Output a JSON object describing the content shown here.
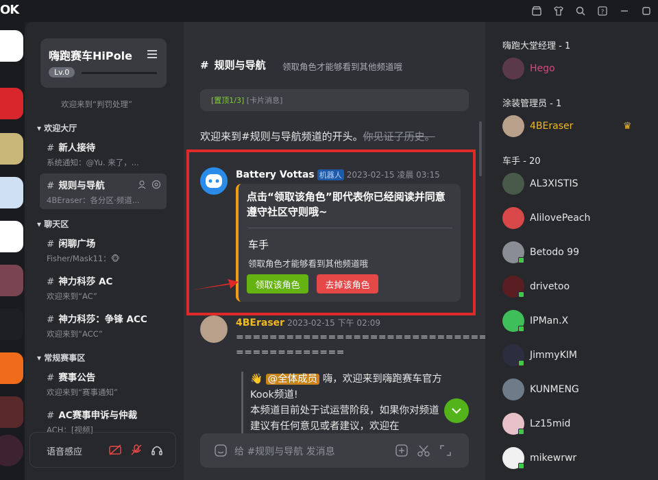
{
  "app": {
    "logo": "OK"
  },
  "guild": {
    "name": "嗨跑赛车HiPole",
    "level": "Lv.0",
    "top_sub": "欢迎来到“判罚处理”"
  },
  "categories": [
    {
      "label": "欢迎大厅",
      "channels": [
        {
          "name": "新人接待",
          "sub": "系统通知：@Yu. 来了，...",
          "active": false
        },
        {
          "name": "规则与导航",
          "sub": "4BEraser：各分区·频道...",
          "active": true
        }
      ]
    },
    {
      "label": "聊天区",
      "channels": [
        {
          "name": "闲聊广场",
          "sub": "Fisher/Mask11：🐵",
          "active": false
        },
        {
          "name": "神力科莎 AC",
          "sub": "欢迎来到“AC”",
          "active": false
        },
        {
          "name": "神力科莎：争锋 ACC",
          "sub": "欢迎来到“ACC”",
          "active": false
        }
      ]
    },
    {
      "label": "常规赛事区",
      "channels": [
        {
          "name": "赛事公告",
          "sub": "欢迎来到“赛事通知”",
          "active": false
        },
        {
          "name": "AC赛事申诉与仲裁",
          "sub": "ACH：[视频]",
          "active": false
        }
      ]
    }
  ],
  "voice": {
    "label": "语音感应"
  },
  "channel": {
    "name": "规则与导航",
    "topic": "领取角色才能够看到其他频道哦"
  },
  "pinbar": {
    "pin": "[置顶1/3]",
    "text": "[卡片消息]"
  },
  "welcome": {
    "text": "欢迎来到#规则与导航频道的开头。",
    "strike": "你见证了历史。"
  },
  "bot_message": {
    "author": "Battery Vottas",
    "tag": "机器人",
    "time": "2023-02-15 凌晨 03:15",
    "card_title": "点击“领取该角色”即代表你已经阅读并同意遵守社区守则哦~",
    "role": "车手",
    "desc": "领取角色才能够看到其他频道哦",
    "btn_claim": "领取该角色",
    "btn_remove": "去掉该角色"
  },
  "user_message": {
    "author": "4BEraser",
    "time": "2023-02-15 下午 02:09",
    "eq1": "================================",
    "eq2": "=============",
    "mention": "@全体成员",
    "line1": "嗨，欢迎来到嗨跑赛车官方Kook频道!",
    "line2": "本频道目前处于试运营阶段，如果你对频道",
    "line3": "建议有任何意见或者建议，欢迎在"
  },
  "composer": {
    "placeholder": "给 #规则与导航 发消息"
  },
  "member_groups": [
    {
      "label": "嗨跑大堂经理 - 1",
      "members": [
        {
          "name": "Hego",
          "color": "#e0457b",
          "crown": false
        }
      ]
    },
    {
      "label": "涂装管理员 - 1",
      "members": [
        {
          "name": "4BEraser",
          "color": "#f2b91f",
          "crown": true
        }
      ]
    },
    {
      "label": "车手 - 20",
      "members": [
        {
          "name": "AL3XISTIS",
          "color": "#e6e6e6",
          "crown": false
        },
        {
          "name": "AlilovePeach",
          "color": "#e6e6e6",
          "crown": false
        },
        {
          "name": "Betodo 99",
          "color": "#e6e6e6",
          "crown": false
        },
        {
          "name": "drivetoo",
          "color": "#e6e6e6",
          "crown": false
        },
        {
          "name": "IPMan.X",
          "color": "#e6e6e6",
          "crown": false
        },
        {
          "name": "JimmyKIM",
          "color": "#e6e6e6",
          "crown": false
        },
        {
          "name": "KUNMENG",
          "color": "#e6e6e6",
          "crown": false
        },
        {
          "name": "Lz15mid",
          "color": "#e6e6e6",
          "crown": false
        },
        {
          "name": "mikewrwr",
          "color": "#e6e6e6",
          "crown": false
        }
      ]
    }
  ],
  "colors": {
    "accent_green": "#64b311",
    "danger_red": "#e64747",
    "highlight_border": "#e02a2a"
  }
}
